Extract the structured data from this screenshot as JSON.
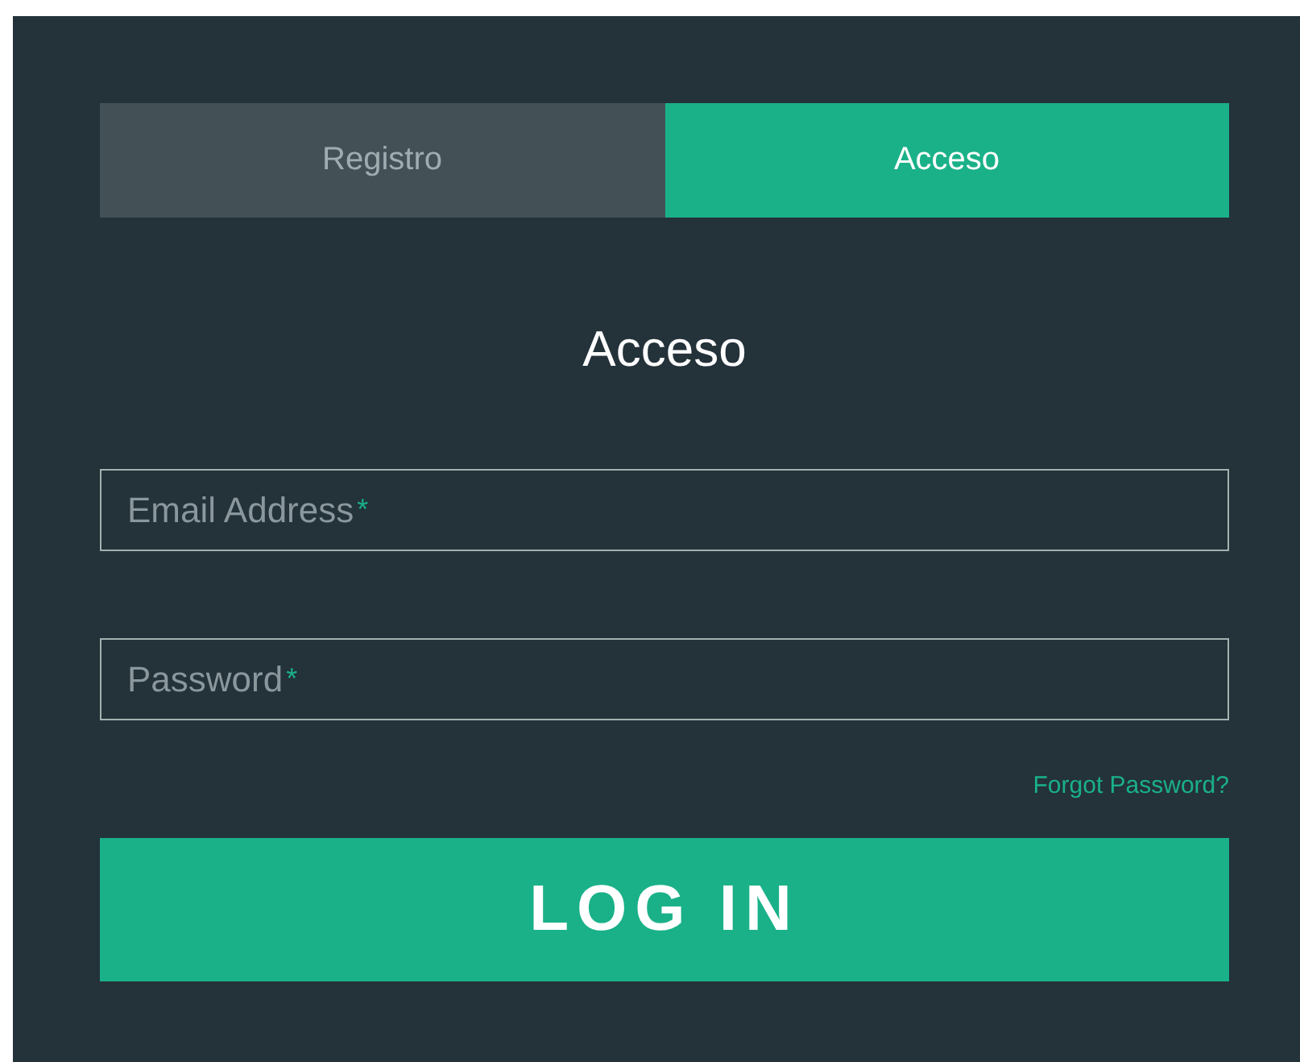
{
  "tabs": [
    {
      "label": "Registro",
      "selected": false
    },
    {
      "label": "Acceso",
      "selected": true
    }
  ],
  "title": "Acceso",
  "fields": [
    {
      "label": "Email Address",
      "required_mark": "*"
    },
    {
      "label": "Password",
      "required_mark": "*"
    }
  ],
  "forgot_link": "Forgot Password?",
  "submit_button": "LOG IN"
}
